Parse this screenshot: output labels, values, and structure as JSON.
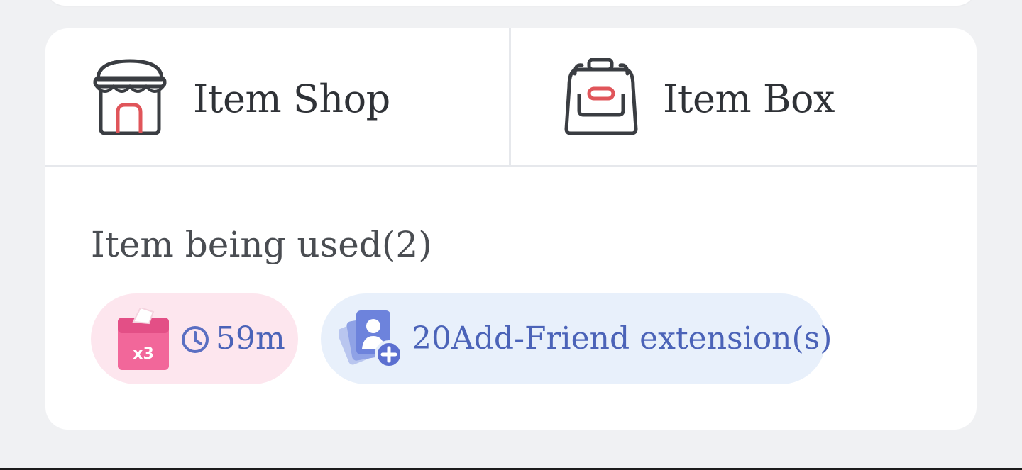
{
  "tabs": {
    "shop_label": "Item Shop",
    "box_label": "Item Box"
  },
  "in_use": {
    "title": "Item being used(2)",
    "items": [
      {
        "icon": "gift-box-x3-icon",
        "badge_text": "x3",
        "timer": "59m"
      },
      {
        "icon": "add-friend-cards-icon",
        "text": "20Add-Friend extension(s)"
      }
    ]
  },
  "colors": {
    "background": "#f0f1f3",
    "card": "#ffffff",
    "pink_chip": "#fde6ee",
    "blue_chip": "#e8f0fb",
    "accent_blue": "#4b63b8",
    "accent_red": "#e0555a",
    "pink_box": "#f2679a"
  }
}
